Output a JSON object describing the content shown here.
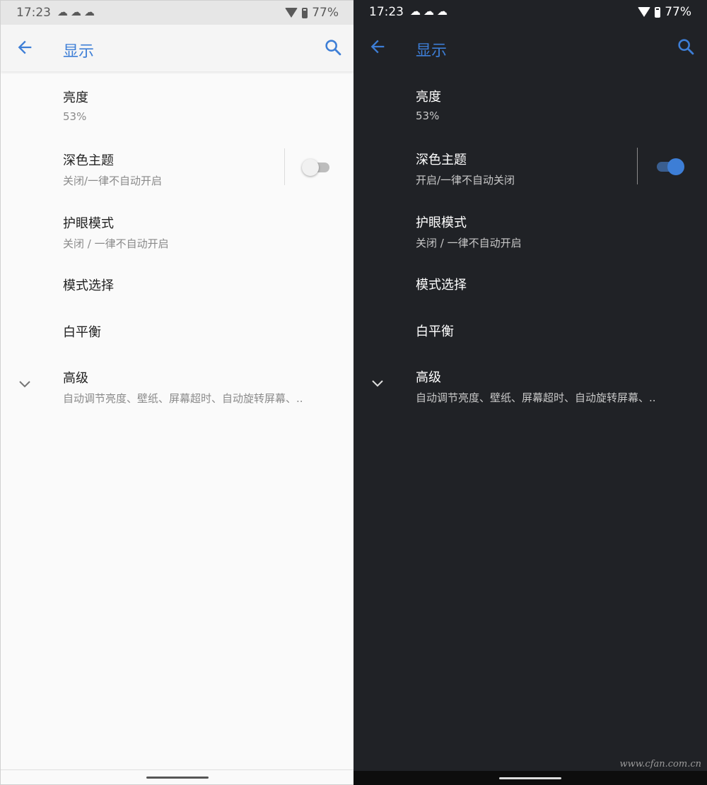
{
  "status_bar": {
    "time": "17:23",
    "battery": "77%"
  },
  "app_bar": {
    "title": "显示"
  },
  "items": {
    "brightness": {
      "title": "亮度",
      "value": "53%"
    },
    "dark_theme": {
      "title": "深色主题",
      "light_summary": "关闭/一律不自动开启",
      "dark_summary": "开启/一律不自动关闭",
      "light_enabled": false,
      "dark_enabled": true
    },
    "eye_mode": {
      "title": "护眼模式",
      "summary": "关闭 / 一律不自动开启"
    },
    "mode_select": {
      "title": "模式选择"
    },
    "white_balance": {
      "title": "白平衡"
    },
    "advanced": {
      "title": "高级",
      "summary": "自动调节亮度、壁纸、屏幕超时、自动旋转屏幕、.."
    }
  },
  "colors": {
    "accent": "#3d7ed6",
    "light_background": "#fafafa",
    "dark_background": "#202226"
  },
  "icons": {
    "back": "arrow-back-icon",
    "search": "search-icon",
    "expand": "chevron-down-icon",
    "wifi": "wifi-icon",
    "battery": "battery-icon",
    "notifications": "weather-notification-icons"
  },
  "watermark": "www.cfan.com.cn"
}
